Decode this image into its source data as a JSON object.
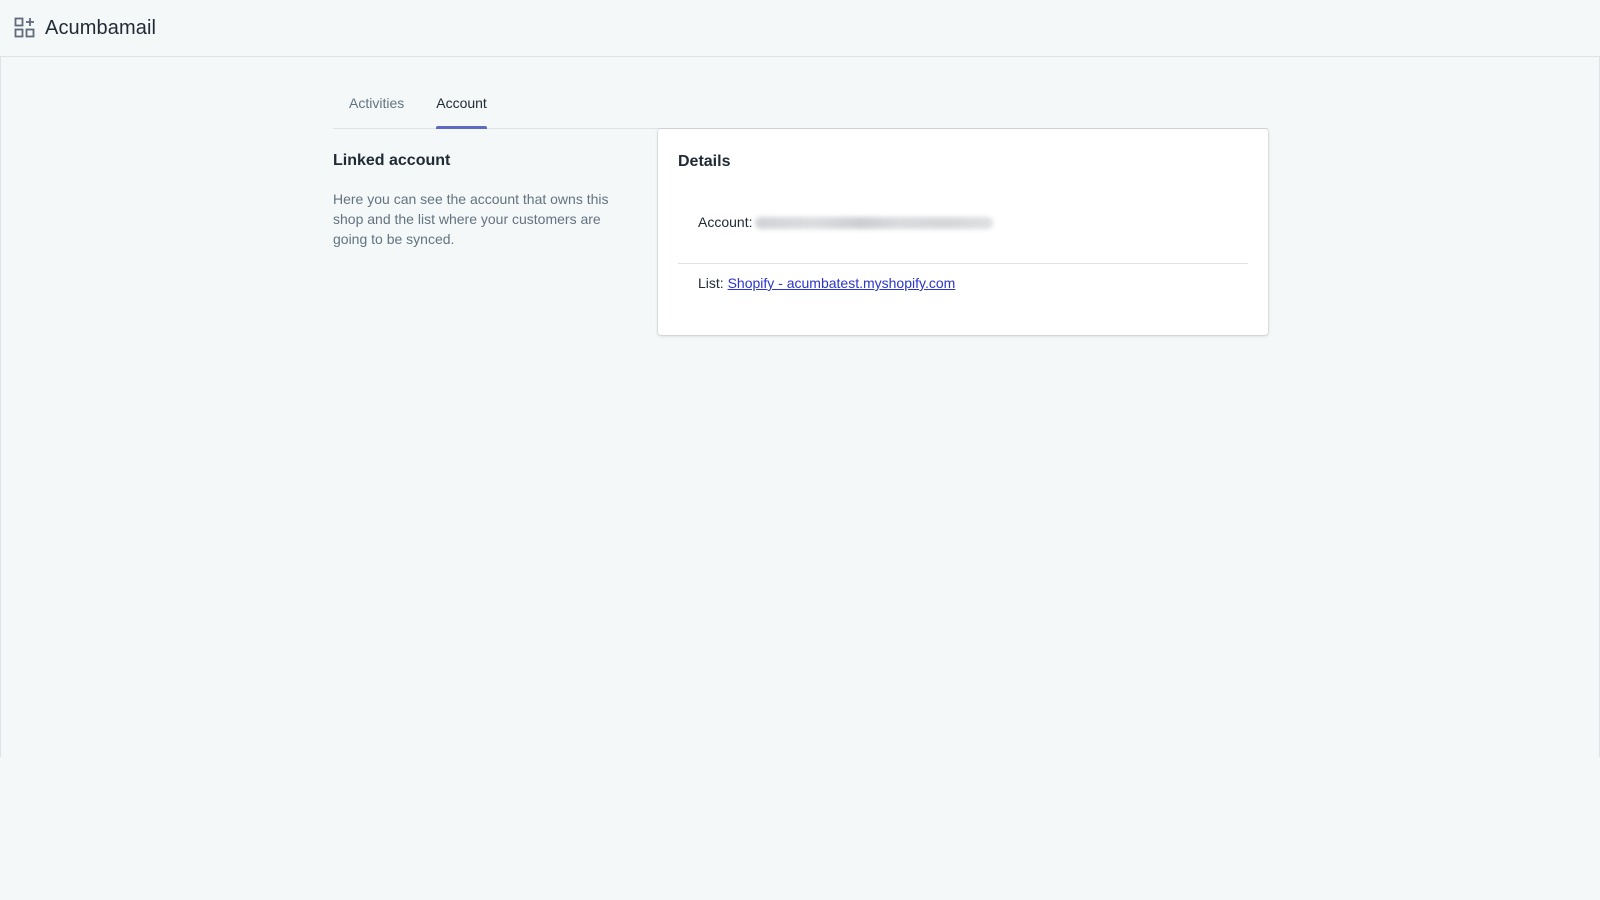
{
  "header": {
    "title": "Acumbamail",
    "icon": "apps-add-icon"
  },
  "tabs": [
    {
      "label": "Activities",
      "active": false
    },
    {
      "label": "Account",
      "active": true
    }
  ],
  "annotation": {
    "title": "Linked account",
    "description": "Here you can see the account that owns this shop and the list where your customers are going to be synced."
  },
  "details_card": {
    "title": "Details",
    "account_label": "Account:",
    "list_label": "List:",
    "list_link": "Shopify - acumbatest.myshopify.com"
  },
  "colors": {
    "background": "#f4f8f8",
    "accent": "#5c6ac4",
    "link": "#2b35c7",
    "text_primary": "#212b36",
    "text_secondary": "#637381"
  }
}
